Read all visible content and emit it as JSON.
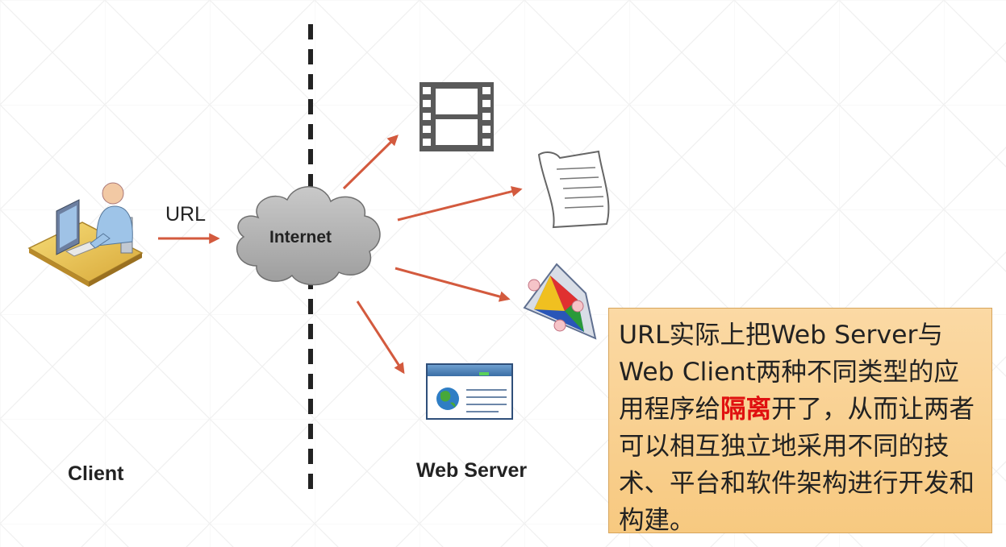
{
  "labels": {
    "client": "Client",
    "url": "URL",
    "internet": "Internet",
    "web_server": "Web Server"
  },
  "note": {
    "before": "URL实际上把Web Server与Web Client两种不同类型的应用程序给",
    "highlight": "隔离",
    "after": "开了，从而让两者可以相互独立地采用不同的技术、平台和软件架构进行开发和构建。"
  },
  "colors": {
    "arrow": "#d35a3e",
    "note_background": "#f9d08f",
    "highlight": "#e01010",
    "cloud": "#b3b3b3"
  },
  "icons": [
    "user-computer-icon",
    "cloud-icon",
    "film-icon",
    "document-icon",
    "application-icon",
    "webpage-icon"
  ]
}
